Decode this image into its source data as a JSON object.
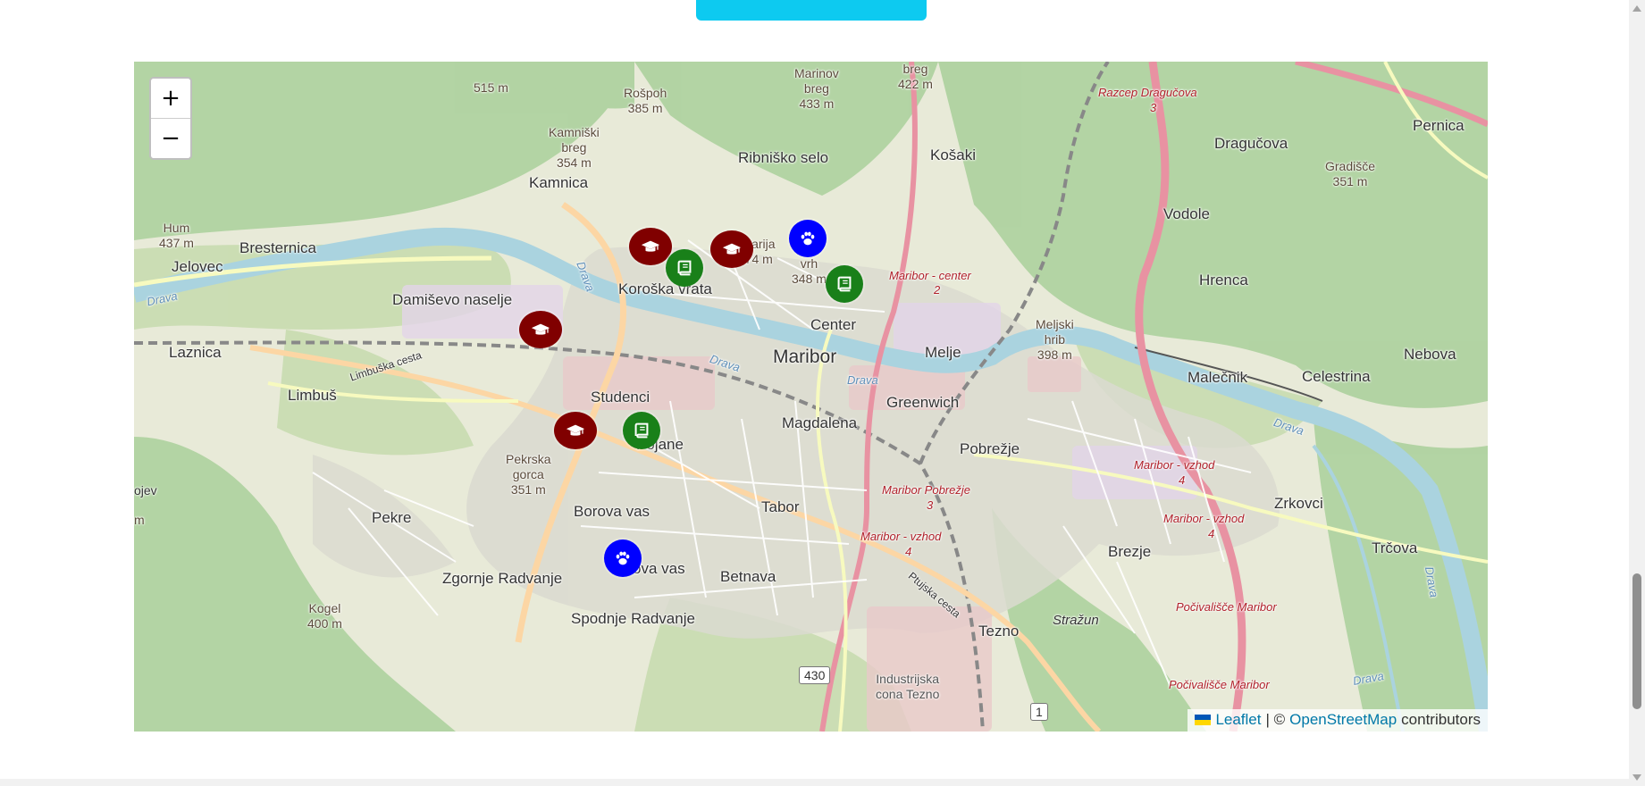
{
  "colors": {
    "button": "#0dcaf0",
    "marker_school": "#800000",
    "marker_library": "#198019",
    "marker_pet": "#0000ff",
    "link": "#0078a8"
  },
  "map": {
    "zoom_in_label": "+",
    "zoom_out_label": "−",
    "places": [
      "Kamnica",
      "Ribniško selo",
      "Košaki",
      "Dragučova",
      "Pernica",
      "Vodole",
      "Hrenca",
      "Bresternica",
      "Jelovec",
      "Damiševo naselje",
      "Koroška vrata",
      "Center",
      "Maribor",
      "Melje",
      "Laznica",
      "Limbuš",
      "Studenci",
      "Magdalena",
      "Greenwich",
      "Pobrežje",
      "Malečnik",
      "Celestrina",
      "Nebova",
      "Pekre",
      "Tabor",
      "Borova vas",
      "Zgornje Radvanje",
      "Spodnje Radvanje",
      "Betnava",
      "Brezje",
      "Zrkovci",
      "Tezno",
      "Trčova",
      "Pobrežje",
      "Pekre"
    ],
    "label_texts": {
      "kamnica": "Kamnica",
      "ribnisko": "Ribniško selo",
      "kosaki": "Košaki",
      "dragucova": "Dragučova",
      "pernica": "Pernica",
      "vodole": "Vodole",
      "hrenca": "Hrenca",
      "bresternica": "Bresternica",
      "jelovec": "Jelovec",
      "damisevo": "Damiševo naselje",
      "koroska": "Koroška vrata",
      "center": "Center",
      "maribor": "Maribor",
      "melje": "Melje",
      "laznica": "Laznica",
      "limbus": "Limbuš",
      "studenci": "Studenci",
      "magdalena": "Magdalena",
      "greenwich": "Greenwich",
      "pobrezje": "Pobrežje",
      "malecnik": "Malečnik",
      "celestrina": "Celestrina",
      "nebova": "Nebova",
      "pekre": "Pekre",
      "tabor": "Tabor",
      "borova": "Borova vas",
      "novavas": "ova vas",
      "zgornje": "Zgornje Radvanje",
      "spodnje": "Spodnje Radvanje",
      "betnava": "Betnava",
      "brezje": "Brezje",
      "zrkovci": "Zrkovci",
      "tezno": "Tezno",
      "trcova": "Trčova",
      "pobrezje_small": "Pobrežje",
      "stranzun": "Stražun",
      "industrijska": "Industrijska\ncona Tezno",
      "pojane": "Pojane",
      "ojev": "ojev"
    },
    "peaks": {
      "m515": "515 m",
      "rospoh": "Rošpoh\n385 m",
      "kamniski": "Kamniški\nbreg\n354 m",
      "marinov": "Marinov\nbreg\n433 m",
      "breg422": "breg\n422 m",
      "hum": "Hum\n437 m",
      "kalvarija": "lvarija\n74 m",
      "vrh348": "ni\nvrh\n348 m",
      "gradisce": "Gradišče\n351 m",
      "meljski": "Meljski\nhrib\n398 m",
      "pekrska": "Pekrska\ngorca\n351 m",
      "kogel": "Kogel\n400 m",
      "m": "m"
    },
    "roads": {
      "dragucova_razcep": "Razcep Dragučova",
      "dragucova_razcep_num": "3",
      "maribor_center": "Maribor - center",
      "maribor_center_num": "2",
      "maribor_vzhod1": "Maribor - vzhod",
      "maribor_vzhod1_num": "4",
      "maribor_vzhod2": "Maribor - vzhod",
      "maribor_vzhod2_num": "4",
      "pobrezje_exit": "Maribor Pobrežje",
      "pobrezje_exit_num": "3",
      "vzhod3": "Maribor - vzhod",
      "vzhod3_num": "4",
      "pocivalisce1": "Počivališče Maribor",
      "pocivalisce2": "Počivališče Maribor",
      "ptujska": "Ptujska cesta",
      "limbuska": "Limbuška cesta"
    },
    "rivers": {
      "drava1": "Drava",
      "drava2": "Drava",
      "drava3": "Drava",
      "drava4": "Drava",
      "drava5": "Drava",
      "drava6": "Drava",
      "drava7": "Drava"
    },
    "shields": {
      "s430": "430",
      "s1": "1"
    },
    "markers": [
      {
        "kind": "school",
        "icon": "graduation-cap-icon"
      },
      {
        "kind": "library",
        "icon": "book-icon"
      },
      {
        "kind": "school",
        "icon": "graduation-cap-icon"
      },
      {
        "kind": "pet",
        "icon": "paw-icon"
      },
      {
        "kind": "library",
        "icon": "book-icon"
      },
      {
        "kind": "school",
        "icon": "graduation-cap-icon"
      },
      {
        "kind": "school",
        "icon": "graduation-cap-icon"
      },
      {
        "kind": "library",
        "icon": "book-icon"
      },
      {
        "kind": "pet",
        "icon": "paw-icon"
      }
    ],
    "attribution": {
      "leaflet": "Leaflet",
      "separator": "| ©",
      "osm": "OpenStreetMap",
      "contributors": "contributors"
    }
  }
}
